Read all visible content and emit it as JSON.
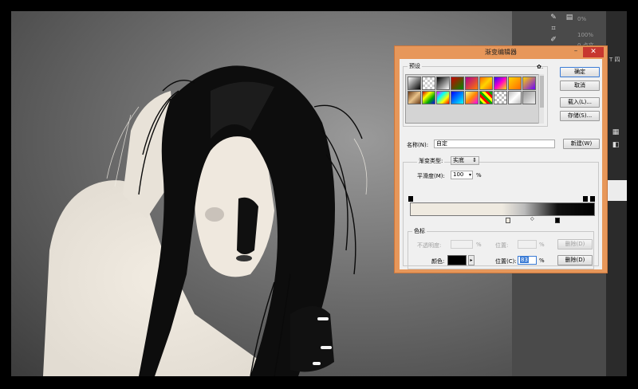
{
  "dialog": {
    "title": "渐变编辑器",
    "close_symbol": "✕",
    "minimize_symbol": "–",
    "presets_label": "预设",
    "gear_symbol": "✿.",
    "buttons": {
      "ok": "确定",
      "cancel": "取消",
      "load": "载入(L)...",
      "save": "存储(S)...",
      "new": "新建(W)"
    },
    "name_label": "名称(N):",
    "name_value": "自定",
    "gradient_type_label": "渐变类型:",
    "gradient_type_value": "实底",
    "smoothness_label": "平滑度(M):",
    "smoothness_value": "100",
    "percent": "%",
    "stops_label": "色标",
    "opacity_label": "不透明度:",
    "location_label": "位置:",
    "delete_label": "删除(D)",
    "color_label": "颜色:",
    "location_c_label": "位置(C):",
    "location_c_value": "83",
    "preset_swatches": [
      "linear-gradient(135deg,#fff,#000)",
      "repeating-conic-gradient(#ccc 0 25%, #fff 0 50%) 0 0/6px 6px",
      "linear-gradient(135deg,#000,#fff)",
      "linear-gradient(135deg,#c00,#080)",
      "linear-gradient(135deg,#b0008f,#ff7a00)",
      "linear-gradient(135deg,#ff6a00,#ffd400,#ff6a00)",
      "linear-gradient(135deg,#2a00ff,#ff00c8,#ffe400)",
      "linear-gradient(135deg,#ffd400,#ff6a00)",
      "linear-gradient(135deg,#ffd400,#6a00ff)",
      "linear-gradient(135deg,#ff00c8,#ffe400)",
      "linear-gradient(135deg,#3b2e8f,#ffb200)",
      "linear-gradient(135deg,#6b3b16,#e8c28a,#6b3b16)",
      "linear-gradient(135deg,#c00,#ff0,#0a0,#00f)",
      "linear-gradient(135deg,#f0f,#0ff,#ff0,#f00)",
      "linear-gradient(135deg,#00f,#0ff)",
      "linear-gradient(135deg,#ff8,#f80,#f0f)",
      "repeating-linear-gradient(45deg,#0a0 0 3px,#ff0 3px 6px,#f00 6px 9px)",
      "repeating-conic-gradient(#bbb 0 25%, #fff 0 50%) 0 0/6px 6px",
      "linear-gradient(135deg,#bdbdbd,#fff,#bdbdbd)",
      "linear-gradient(135deg,#999,#eee)",
      "linear-gradient(135deg,#ff0,#f80,#c00)",
      "linear-gradient(135deg,#5a00c8,#ff009a)"
    ]
  },
  "right_panel": {
    "zoom_1": "0%",
    "zoom_2": "100%",
    "text_1": "0 点文",
    "text_2": "T 四"
  }
}
